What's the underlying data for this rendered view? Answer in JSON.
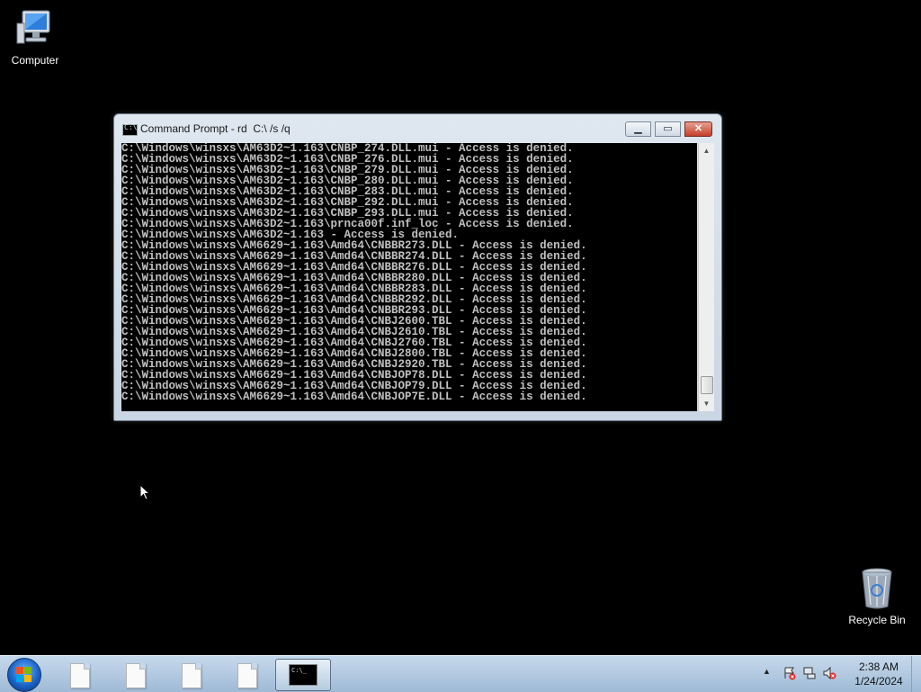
{
  "desktop": {
    "icons": [
      {
        "label": "Computer",
        "icon": "computer-icon"
      },
      {
        "label": "Recycle Bin",
        "icon": "recycle-bin-icon"
      }
    ]
  },
  "window": {
    "title": "Command Prompt - rd  C:\\ /s /q",
    "buttons": {
      "minimize": "minimize",
      "maximize": "maximize",
      "close": "close"
    },
    "console_lines": [
      "C:\\Windows\\winsxs\\AM63D2~1.163\\CNBP_274.DLL.mui - Access is denied.",
      "C:\\Windows\\winsxs\\AM63D2~1.163\\CNBP_276.DLL.mui - Access is denied.",
      "C:\\Windows\\winsxs\\AM63D2~1.163\\CNBP_279.DLL.mui - Access is denied.",
      "C:\\Windows\\winsxs\\AM63D2~1.163\\CNBP_280.DLL.mui - Access is denied.",
      "C:\\Windows\\winsxs\\AM63D2~1.163\\CNBP_283.DLL.mui - Access is denied.",
      "C:\\Windows\\winsxs\\AM63D2~1.163\\CNBP_292.DLL.mui - Access is denied.",
      "C:\\Windows\\winsxs\\AM63D2~1.163\\CNBP_293.DLL.mui - Access is denied.",
      "C:\\Windows\\winsxs\\AM63D2~1.163\\prnca00f.inf_loc - Access is denied.",
      "C:\\Windows\\winsxs\\AM63D2~1.163 - Access is denied.",
      "C:\\Windows\\winsxs\\AM6629~1.163\\Amd64\\CNBBR273.DLL - Access is denied.",
      "C:\\Windows\\winsxs\\AM6629~1.163\\Amd64\\CNBBR274.DLL - Access is denied.",
      "C:\\Windows\\winsxs\\AM6629~1.163\\Amd64\\CNBBR276.DLL - Access is denied.",
      "C:\\Windows\\winsxs\\AM6629~1.163\\Amd64\\CNBBR280.DLL - Access is denied.",
      "C:\\Windows\\winsxs\\AM6629~1.163\\Amd64\\CNBBR283.DLL - Access is denied.",
      "C:\\Windows\\winsxs\\AM6629~1.163\\Amd64\\CNBBR292.DLL - Access is denied.",
      "C:\\Windows\\winsxs\\AM6629~1.163\\Amd64\\CNBBR293.DLL - Access is denied.",
      "C:\\Windows\\winsxs\\AM6629~1.163\\Amd64\\CNBJ2600.TBL - Access is denied.",
      "C:\\Windows\\winsxs\\AM6629~1.163\\Amd64\\CNBJ2610.TBL - Access is denied.",
      "C:\\Windows\\winsxs\\AM6629~1.163\\Amd64\\CNBJ2760.TBL - Access is denied.",
      "C:\\Windows\\winsxs\\AM6629~1.163\\Amd64\\CNBJ2800.TBL - Access is denied.",
      "C:\\Windows\\winsxs\\AM6629~1.163\\Amd64\\CNBJ2920.TBL - Access is denied.",
      "C:\\Windows\\winsxs\\AM6629~1.163\\Amd64\\CNBJOP78.DLL - Access is denied.",
      "C:\\Windows\\winsxs\\AM6629~1.163\\Amd64\\CNBJOP79.DLL - Access is denied.",
      "C:\\Windows\\winsxs\\AM6629~1.163\\Amd64\\CNBJOP7E.DLL - Access is denied."
    ]
  },
  "taskbar": {
    "start_icon": "windows-start-icon",
    "items": [
      {
        "icon": "document-icon"
      },
      {
        "icon": "document-icon"
      },
      {
        "icon": "document-icon"
      },
      {
        "icon": "document-icon"
      },
      {
        "icon": "command-prompt-icon",
        "active": true
      }
    ],
    "tray": {
      "icons": [
        "show-hidden-icons-arrow",
        "action-center-icon",
        "network-icon",
        "volume-muted-icon"
      ],
      "time": "2:38 AM",
      "date": "1/24/2024"
    }
  },
  "colors": {
    "desktop_background": "#000000",
    "console_text": "#c0c0c0",
    "taskbar": "#b3cbe3"
  }
}
